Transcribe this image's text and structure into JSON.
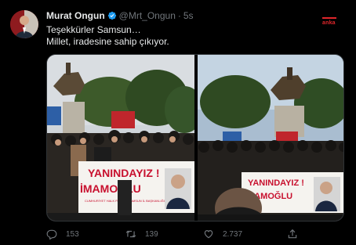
{
  "tweet": {
    "author_name": "Murat Ongun",
    "author_handle": "@Mrt_Ongun",
    "separator": "·",
    "time": "5s",
    "brand": "anka",
    "text_lines": [
      "Teşekkürler Samsun…",
      "Millet, iradesine sahip çıkıyor."
    ]
  },
  "media": {
    "left_banner_line1": "YANINDAYIZ !",
    "left_banner_line2": "İMAMOĞLU",
    "left_banner_small": "CUMHURİYET HALK PARTİSİ\nSAMSUN İL BAŞKANLIĞI",
    "right_banner_line1": "YANINDAYIZ !",
    "right_banner_line2": "İMAMOĞLU"
  },
  "actions": {
    "reply_count": "153",
    "retweet_count": "139",
    "like_count": "2.737"
  },
  "colors": {
    "background": "#000000",
    "text": "#e7e9ea",
    "muted": "#71767b",
    "verified": "#1d9bf0",
    "brand": "#e0262b"
  },
  "icons": [
    "verified-badge-icon",
    "reply-icon",
    "retweet-icon",
    "like-icon",
    "share-icon"
  ]
}
